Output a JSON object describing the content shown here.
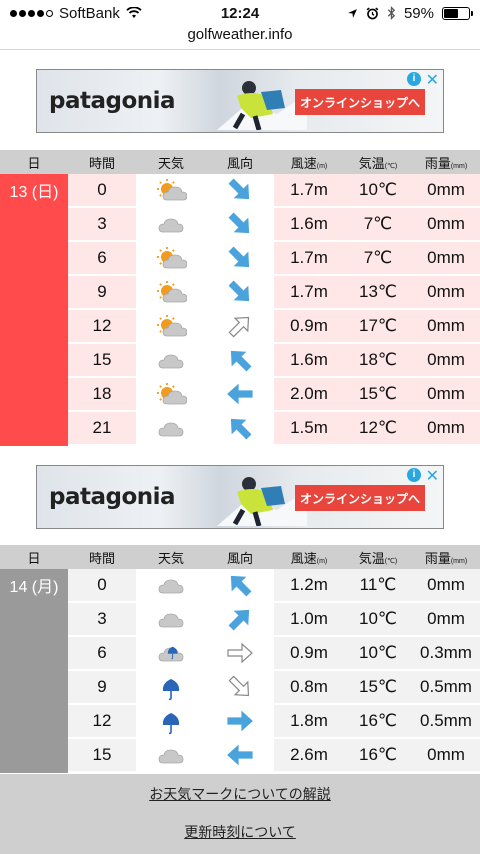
{
  "status": {
    "carrier": "SoftBank",
    "time": "12:24",
    "battery": "59%",
    "battery_level": 0.59
  },
  "url": "golfweather.info",
  "ad": {
    "brand": "patagonia",
    "cta": "オンラインショップへ",
    "info": "i",
    "close": "✕"
  },
  "headers": {
    "day": "日",
    "time": "時間",
    "weather": "天気",
    "wind_dir": "風向",
    "wind_speed": "風速",
    "wind_speed_unit": "(m)",
    "temp": "気温",
    "temp_unit": "(℃)",
    "rain": "雨量",
    "rain_unit": "(mm)"
  },
  "day1": {
    "label": "13 (日)",
    "rows": [
      {
        "time": "0",
        "weather": "sun-cloud",
        "dir": 45,
        "dir_style": "blue",
        "speed": "1.7m",
        "temp": "10℃",
        "rain": "0mm"
      },
      {
        "time": "3",
        "weather": "cloud",
        "dir": 45,
        "dir_style": "blue",
        "speed": "1.6m",
        "temp": "7℃",
        "rain": "0mm"
      },
      {
        "time": "6",
        "weather": "sun-cloud",
        "dir": 45,
        "dir_style": "blue",
        "speed": "1.7m",
        "temp": "7℃",
        "rain": "0mm"
      },
      {
        "time": "9",
        "weather": "sun-cloud",
        "dir": 45,
        "dir_style": "blue",
        "speed": "1.7m",
        "temp": "13℃",
        "rain": "0mm"
      },
      {
        "time": "12",
        "weather": "sun-cloud",
        "dir": -45,
        "dir_style": "outline",
        "speed": "0.9m",
        "temp": "17℃",
        "rain": "0mm"
      },
      {
        "time": "15",
        "weather": "cloud",
        "dir": -135,
        "dir_style": "blue",
        "speed": "1.6m",
        "temp": "18℃",
        "rain": "0mm"
      },
      {
        "time": "18",
        "weather": "sun-cloud",
        "dir": 180,
        "dir_style": "blue",
        "speed": "2.0m",
        "temp": "15℃",
        "rain": "0mm"
      },
      {
        "time": "21",
        "weather": "cloud",
        "dir": -135,
        "dir_style": "blue",
        "speed": "1.5m",
        "temp": "12℃",
        "rain": "0mm"
      }
    ]
  },
  "day2": {
    "label": "14 (月)",
    "rows": [
      {
        "time": "0",
        "weather": "cloud",
        "dir": -135,
        "dir_style": "blue-up",
        "speed": "1.2m",
        "temp": "11℃",
        "rain": "0mm"
      },
      {
        "time": "3",
        "weather": "cloud",
        "dir": -45,
        "dir_style": "blue",
        "speed": "1.0m",
        "temp": "10℃",
        "rain": "0mm"
      },
      {
        "time": "6",
        "weather": "cloud-umbrella",
        "dir": 0,
        "dir_style": "outline",
        "speed": "0.9m",
        "temp": "10℃",
        "rain": "0.3mm"
      },
      {
        "time": "9",
        "weather": "umbrella",
        "dir": 45,
        "dir_style": "outline",
        "speed": "0.8m",
        "temp": "15℃",
        "rain": "0.5mm"
      },
      {
        "time": "12",
        "weather": "umbrella",
        "dir": 0,
        "dir_style": "blue",
        "speed": "1.8m",
        "temp": "16℃",
        "rain": "0.5mm"
      },
      {
        "time": "15",
        "weather": "cloud",
        "dir": 180,
        "dir_style": "blue",
        "speed": "2.6m",
        "temp": "16℃",
        "rain": "0mm"
      }
    ]
  },
  "colors": {
    "day1": "#ff4b4b",
    "day2": "#9a9a9a",
    "arrow": "#4aa3dc"
  },
  "footer": {
    "link1": "お天気マークについての解説",
    "link2": "更新時刻について"
  }
}
